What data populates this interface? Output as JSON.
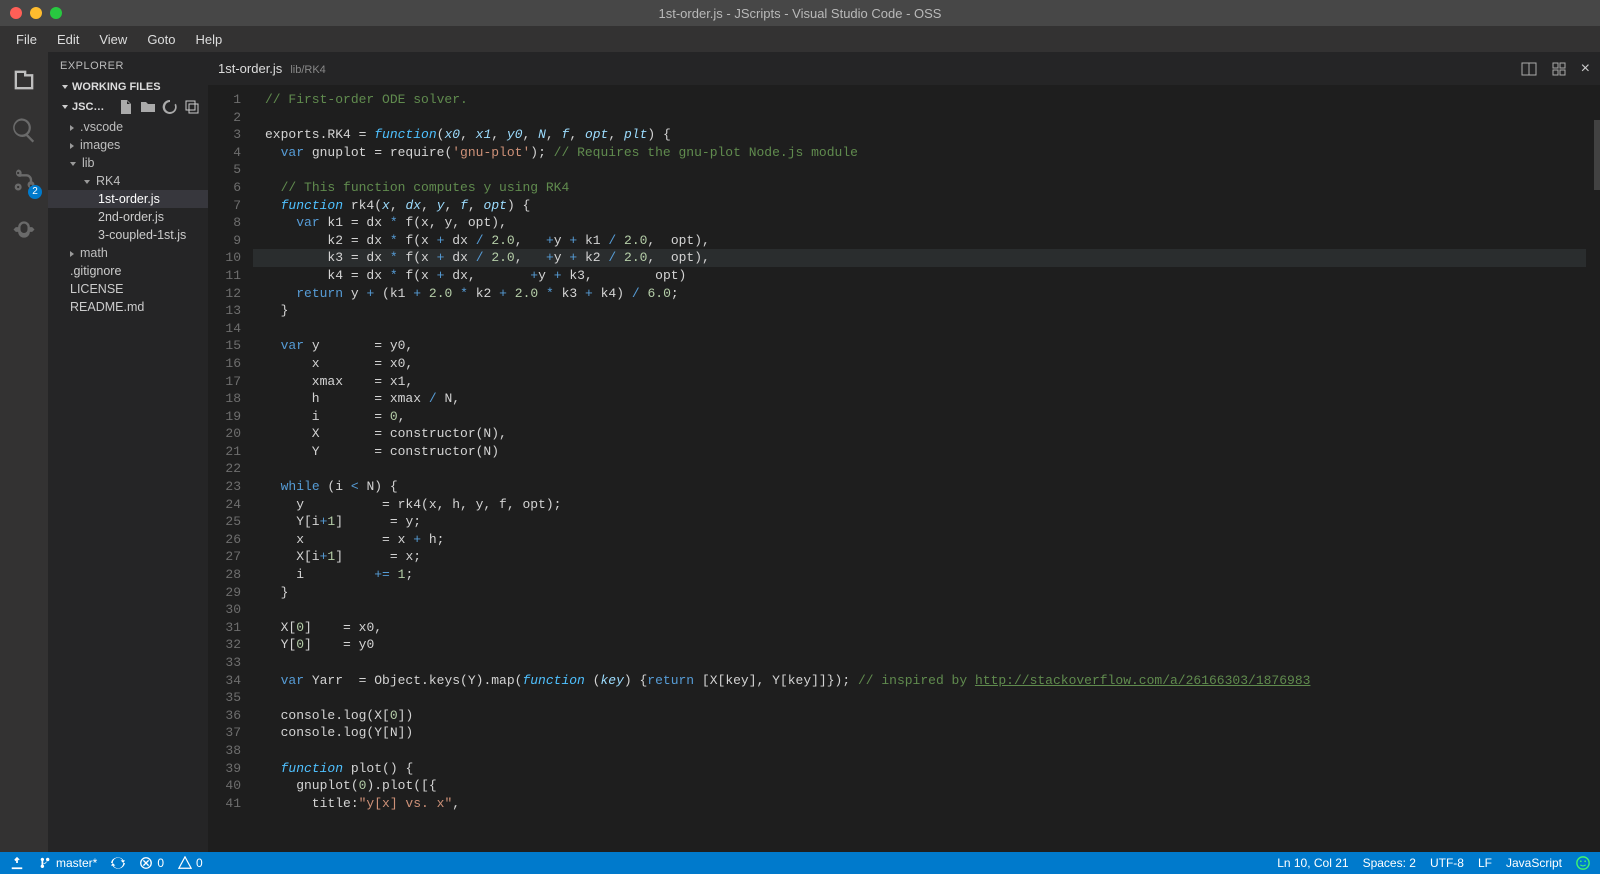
{
  "title": "1st-order.js - JScripts - Visual Studio Code - OSS",
  "menubar": [
    "File",
    "Edit",
    "View",
    "Goto",
    "Help"
  ],
  "activitybar": {
    "badge": "2"
  },
  "sidebar": {
    "header": "EXPLORER",
    "working_files": "WORKING FILES",
    "project": "JSC…",
    "tree": [
      {
        "label": ".vscode",
        "depth": 1,
        "type": "folder"
      },
      {
        "label": "images",
        "depth": 1,
        "type": "folder"
      },
      {
        "label": "lib",
        "depth": 1,
        "type": "folder",
        "open": true
      },
      {
        "label": "RK4",
        "depth": 2,
        "type": "folder",
        "open": true
      },
      {
        "label": "1st-order.js",
        "depth": 3,
        "type": "file",
        "selected": true
      },
      {
        "label": "2nd-order.js",
        "depth": 3,
        "type": "file"
      },
      {
        "label": "3-coupled-1st.js",
        "depth": 3,
        "type": "file"
      },
      {
        "label": "math",
        "depth": 1,
        "type": "folder"
      },
      {
        "label": ".gitignore",
        "depth": 1,
        "type": "file"
      },
      {
        "label": "LICENSE",
        "depth": 1,
        "type": "file"
      },
      {
        "label": "README.md",
        "depth": 1,
        "type": "file"
      }
    ]
  },
  "tab": {
    "name": "1st-order.js",
    "path": "lib/RK4"
  },
  "code": {
    "highlight_line": 10,
    "lines": [
      [
        [
          "c0",
          "// First-order ODE solver."
        ]
      ],
      [
        [
          "",
          " "
        ]
      ],
      [
        [
          "",
          "exports.RK4 = "
        ],
        [
          "c5 it",
          "function"
        ],
        [
          "",
          "("
        ],
        [
          "c4 it",
          "x0"
        ],
        [
          "",
          ", "
        ],
        [
          "c4 it",
          "x1"
        ],
        [
          "",
          ", "
        ],
        [
          "c4 it",
          "y0"
        ],
        [
          "",
          ", "
        ],
        [
          "c4 it",
          "N"
        ],
        [
          "",
          ", "
        ],
        [
          "c4 it",
          "f"
        ],
        [
          "",
          ", "
        ],
        [
          "c4 it",
          "opt"
        ],
        [
          "",
          ", "
        ],
        [
          "c4 it",
          "plt"
        ],
        [
          "",
          ") {"
        ]
      ],
      [
        [
          "",
          "  "
        ],
        [
          "c1",
          "var"
        ],
        [
          "",
          " gnuplot = require("
        ],
        [
          "c2",
          "'gnu-plot'"
        ],
        [
          "",
          "); "
        ],
        [
          "c0",
          "// Requires the gnu-plot Node.js module"
        ]
      ],
      [
        [
          "",
          " "
        ]
      ],
      [
        [
          "",
          "  "
        ],
        [
          "c0",
          "// This function computes y using RK4"
        ]
      ],
      [
        [
          "",
          "  "
        ],
        [
          "c5 it",
          "function"
        ],
        [
          "",
          " rk4("
        ],
        [
          "c4 it",
          "x"
        ],
        [
          "",
          ", "
        ],
        [
          "c4 it",
          "dx"
        ],
        [
          "",
          ", "
        ],
        [
          "c4 it",
          "y"
        ],
        [
          "",
          ", "
        ],
        [
          "c4 it",
          "f"
        ],
        [
          "",
          ", "
        ],
        [
          "c4 it",
          "opt"
        ],
        [
          "",
          ") {"
        ]
      ],
      [
        [
          "",
          "    "
        ],
        [
          "c1",
          "var"
        ],
        [
          "",
          " k1 = dx "
        ],
        [
          "c1",
          "*"
        ],
        [
          "",
          " f(x, y, opt),"
        ]
      ],
      [
        [
          "",
          "        k2 = dx "
        ],
        [
          "c1",
          "*"
        ],
        [
          "",
          " f(x "
        ],
        [
          "c1",
          "+"
        ],
        [
          "",
          " dx "
        ],
        [
          "c1",
          "/"
        ],
        [
          "",
          " "
        ],
        [
          "c3",
          "2.0"
        ],
        [
          "",
          ",   "
        ],
        [
          "c1",
          "+"
        ],
        [
          "",
          "y "
        ],
        [
          "c1",
          "+"
        ],
        [
          "",
          " k1 "
        ],
        [
          "c1",
          "/"
        ],
        [
          "",
          " "
        ],
        [
          "c3",
          "2.0"
        ],
        [
          "",
          ",  opt),"
        ]
      ],
      [
        [
          "",
          "        k3 = dx "
        ],
        [
          "c1",
          "*"
        ],
        [
          "",
          " f(x "
        ],
        [
          "c1",
          "+"
        ],
        [
          "",
          " dx "
        ],
        [
          "c1",
          "/"
        ],
        [
          "",
          " "
        ],
        [
          "c3",
          "2.0"
        ],
        [
          "",
          ",   "
        ],
        [
          "c1",
          "+"
        ],
        [
          "",
          "y "
        ],
        [
          "c1",
          "+"
        ],
        [
          "",
          " k2 "
        ],
        [
          "c1",
          "/"
        ],
        [
          "",
          " "
        ],
        [
          "c3",
          "2.0"
        ],
        [
          "",
          ",  opt),"
        ]
      ],
      [
        [
          "",
          "        k4 = dx "
        ],
        [
          "c1",
          "*"
        ],
        [
          "",
          " f(x "
        ],
        [
          "c1",
          "+"
        ],
        [
          "",
          " dx,       "
        ],
        [
          "c1",
          "+"
        ],
        [
          "",
          "y "
        ],
        [
          "c1",
          "+"
        ],
        [
          "",
          " k3,        opt)"
        ]
      ],
      [
        [
          "",
          "    "
        ],
        [
          "c1",
          "return"
        ],
        [
          "",
          " y "
        ],
        [
          "c1",
          "+"
        ],
        [
          "",
          " (k1 "
        ],
        [
          "c1",
          "+"
        ],
        [
          "",
          " "
        ],
        [
          "c3",
          "2.0"
        ],
        [
          "",
          " "
        ],
        [
          "c1",
          "*"
        ],
        [
          "",
          " k2 "
        ],
        [
          "c1",
          "+"
        ],
        [
          "",
          " "
        ],
        [
          "c3",
          "2.0"
        ],
        [
          "",
          " "
        ],
        [
          "c1",
          "*"
        ],
        [
          "",
          " k3 "
        ],
        [
          "c1",
          "+"
        ],
        [
          "",
          " k4) "
        ],
        [
          "c1",
          "/"
        ],
        [
          "",
          " "
        ],
        [
          "c3",
          "6.0"
        ],
        [
          "",
          ";"
        ]
      ],
      [
        [
          "",
          "  }"
        ]
      ],
      [
        [
          "",
          " "
        ]
      ],
      [
        [
          "",
          "  "
        ],
        [
          "c1",
          "var"
        ],
        [
          "",
          " y       = y0,"
        ]
      ],
      [
        [
          "",
          "      x       = x0,"
        ]
      ],
      [
        [
          "",
          "      xmax    = x1,"
        ]
      ],
      [
        [
          "",
          "      h       = xmax "
        ],
        [
          "c1",
          "/"
        ],
        [
          "",
          " N,"
        ]
      ],
      [
        [
          "",
          "      i       = "
        ],
        [
          "c3",
          "0"
        ],
        [
          "",
          ","
        ]
      ],
      [
        [
          "",
          "      X       = constructor(N),"
        ]
      ],
      [
        [
          "",
          "      Y       = constructor(N)"
        ]
      ],
      [
        [
          "",
          " "
        ]
      ],
      [
        [
          "",
          "  "
        ],
        [
          "c1",
          "while"
        ],
        [
          "",
          " (i "
        ],
        [
          "c1",
          "<"
        ],
        [
          "",
          " N) {"
        ]
      ],
      [
        [
          "",
          "    y          = rk4(x, h, y, f, opt);"
        ]
      ],
      [
        [
          "",
          "    Y[i"
        ],
        [
          "c1",
          "+"
        ],
        [
          "c3",
          "1"
        ],
        [
          "",
          "]      = y;"
        ]
      ],
      [
        [
          "",
          "    x          = x "
        ],
        [
          "c1",
          "+"
        ],
        [
          "",
          " h;"
        ]
      ],
      [
        [
          "",
          "    X[i"
        ],
        [
          "c1",
          "+"
        ],
        [
          "c3",
          "1"
        ],
        [
          "",
          "]      = x;"
        ]
      ],
      [
        [
          "",
          "    i         "
        ],
        [
          "c1",
          "+="
        ],
        [
          "",
          " "
        ],
        [
          "c3",
          "1"
        ],
        [
          "",
          ";"
        ]
      ],
      [
        [
          "",
          "  }"
        ]
      ],
      [
        [
          "",
          " "
        ]
      ],
      [
        [
          "",
          "  X["
        ],
        [
          "c3",
          "0"
        ],
        [
          "",
          "]    = x0,"
        ]
      ],
      [
        [
          "",
          "  Y["
        ],
        [
          "c3",
          "0"
        ],
        [
          "",
          "]    = y0"
        ]
      ],
      [
        [
          "",
          " "
        ]
      ],
      [
        [
          "",
          "  "
        ],
        [
          "c1",
          "var"
        ],
        [
          "",
          " Yarr  = Object.keys(Y).map("
        ],
        [
          "c5 it",
          "function"
        ],
        [
          "",
          " ("
        ],
        [
          "c4 it",
          "key"
        ],
        [
          "",
          ") {"
        ],
        [
          "c1",
          "return"
        ],
        [
          "",
          " [X[key], Y[key]]}); "
        ],
        [
          "c0",
          "// inspired by "
        ],
        [
          "lk",
          "http://stackoverflow.com/a/26166303/1876983"
        ]
      ],
      [
        [
          "",
          " "
        ]
      ],
      [
        [
          "",
          "  console.log(X["
        ],
        [
          "c3",
          "0"
        ],
        [
          "",
          "])"
        ]
      ],
      [
        [
          "",
          "  console.log(Y[N])"
        ]
      ],
      [
        [
          "",
          " "
        ]
      ],
      [
        [
          "",
          "  "
        ],
        [
          "c5 it",
          "function"
        ],
        [
          "",
          " plot() {"
        ]
      ],
      [
        [
          "",
          "    gnuplot("
        ],
        [
          "c3",
          "0"
        ],
        [
          "",
          ").plot([{"
        ]
      ],
      [
        [
          "",
          "      title:"
        ],
        [
          "c2",
          "\"y[x] vs. x\""
        ],
        [
          "",
          ","
        ]
      ]
    ]
  },
  "status": {
    "branch": "master*",
    "sync": "",
    "errors": "0",
    "warnings": "0",
    "lncol": "Ln 10, Col 21",
    "spaces": "Spaces: 2",
    "encoding": "UTF-8",
    "eol": "LF",
    "lang": "JavaScript"
  }
}
